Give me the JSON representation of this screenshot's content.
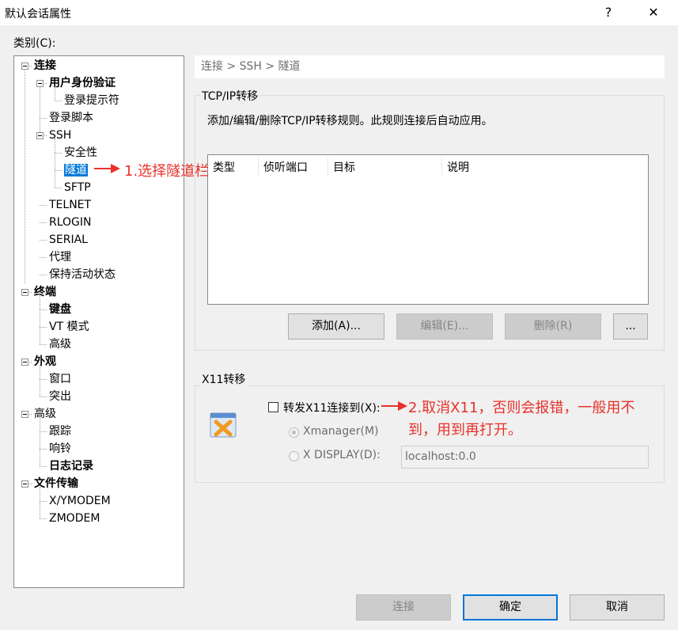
{
  "window": {
    "title": "默认会话属性",
    "help_label": "?",
    "close_label": "✕"
  },
  "category_label": "类别(C):",
  "tree": {
    "items": [
      {
        "label": "连接",
        "bold": true
      },
      {
        "label": "用户身份验证",
        "bold": true
      },
      {
        "label": "登录提示符"
      },
      {
        "label": "登录脚本"
      },
      {
        "label": "SSH"
      },
      {
        "label": "安全性"
      },
      {
        "label": "隧道",
        "selected": true
      },
      {
        "label": "SFTP"
      },
      {
        "label": "TELNET"
      },
      {
        "label": "RLOGIN"
      },
      {
        "label": "SERIAL"
      },
      {
        "label": "代理"
      },
      {
        "label": "保持活动状态"
      },
      {
        "label": "终端",
        "bold": true
      },
      {
        "label": "键盘",
        "bold": true
      },
      {
        "label": "VT 模式"
      },
      {
        "label": "高级"
      },
      {
        "label": "外观",
        "bold": true
      },
      {
        "label": "窗口"
      },
      {
        "label": "突出"
      },
      {
        "label": "高级"
      },
      {
        "label": "跟踪"
      },
      {
        "label": "响铃"
      },
      {
        "label": "日志记录",
        "bold": true
      },
      {
        "label": "文件传输",
        "bold": true
      },
      {
        "label": "X/YMODEM"
      },
      {
        "label": "ZMODEM"
      }
    ]
  },
  "breadcrumb": "连接 > SSH > 隧道",
  "tcp_group": {
    "title": "TCP/IP转移",
    "description": "添加/编辑/删除TCP/IP转移规则。此规则连接后自动应用。",
    "columns": [
      "类型",
      "侦听端口",
      "目标",
      "说明"
    ],
    "add_label": "添加(A)...",
    "edit_label": "编辑(E)...",
    "delete_label": "删除(R)",
    "more_label": "..."
  },
  "x11_group": {
    "title": "X11转移",
    "forward_label": "转发X11连接到(X):",
    "forward_checked": false,
    "xmanager_label": "Xmanager(M)",
    "xdisplay_label": "X DISPLAY(D):",
    "xdisplay_value": "localhost:0.0"
  },
  "annotations": {
    "note1": "1.选择隧道栏",
    "note2_line1": "2.取消X11，否则会报错，一般用不",
    "note2_line2": "到，用到再打开。",
    "color": "#e8312a"
  },
  "footer": {
    "connect_label": "连接",
    "ok_label": "确定",
    "cancel_label": "取消"
  }
}
